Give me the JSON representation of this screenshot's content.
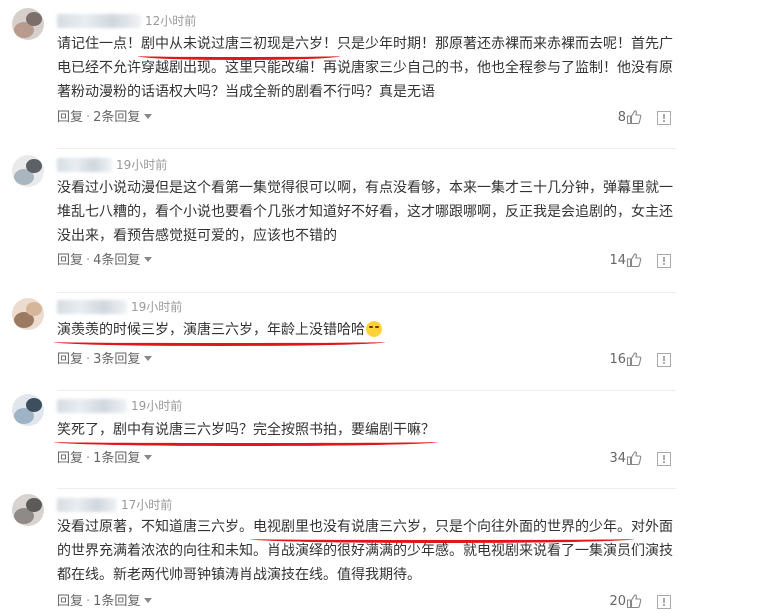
{
  "comments": [
    {
      "time": "12小时前",
      "lines": [
        [
          "请记住一点！",
          {
            "hl": "剧中从未说过唐三初现是六岁！"
          },
          "只是少年时期！那原著还赤裸而来赤裸而去呢！首先广"
        ],
        [
          "电已经不允许穿越剧出现。这里只能改编！再说唐家三少自己的书，他也全程参与了监制！他没有原"
        ],
        [
          "著粉动漫粉的话语权大吗？当成全新的剧看不行吗？真是无语"
        ]
      ],
      "reply_label": "回复",
      "replies_label": "2条回复",
      "likes": "8"
    },
    {
      "time": "19小时前",
      "lines": [
        [
          "没看过小说动漫但是这个看第一集觉得很可以啊，有点没看够，本来一集才三十几分钟，弹幕里就一"
        ],
        [
          "堆乱七八糟的，看个小说也要看个几张才知道好不好看，这才哪跟哪啊，反正我是会追剧的，女主还"
        ],
        [
          "没出来，看预告感觉挺可爱的，应该也不错的"
        ]
      ],
      "reply_label": "回复",
      "replies_label": "4条回复",
      "likes": "14"
    },
    {
      "time": "19小时前",
      "lines": [
        [
          {
            "hl": "演羡羡的时候三岁，演唐三六岁，年龄上没错哈哈",
            "emoji": true
          }
        ]
      ],
      "reply_label": "回复",
      "replies_label": "3条回复",
      "likes": "16"
    },
    {
      "time": "19小时前",
      "lines": [
        [
          {
            "hl": "笑死了，剧中有说唐三六岁吗？完全按照书拍，要编剧干嘛？"
          }
        ]
      ],
      "reply_label": "回复",
      "replies_label": "1条回复",
      "likes": "34"
    },
    {
      "time": "17小时前",
      "lines": [
        [
          "没看过原著，不知道唐三六岁。",
          {
            "hl": "电视剧里也没有说唐三六岁，只是个向往外面的世界的少年。"
          },
          "对外面"
        ],
        [
          "的世界充满着浓浓的向往和未知。肖战演绎的很好满满的少年感。就电视剧来说看了一集演员们演技"
        ],
        [
          "都在线。新老两代帅哥钟镇涛肖战演技在线。值得我期待。"
        ]
      ],
      "reply_label": "回复",
      "replies_label": "1条回复",
      "likes": "20"
    }
  ],
  "colors": {
    "highlight": "#e0161c",
    "text": "#333333",
    "meta": "#999999",
    "like_icon": "#888888"
  },
  "icons": [
    "avatar",
    "thumbs-up-icon",
    "report-icon",
    "chevron-down-icon",
    "laughing-tears-emoji"
  ]
}
